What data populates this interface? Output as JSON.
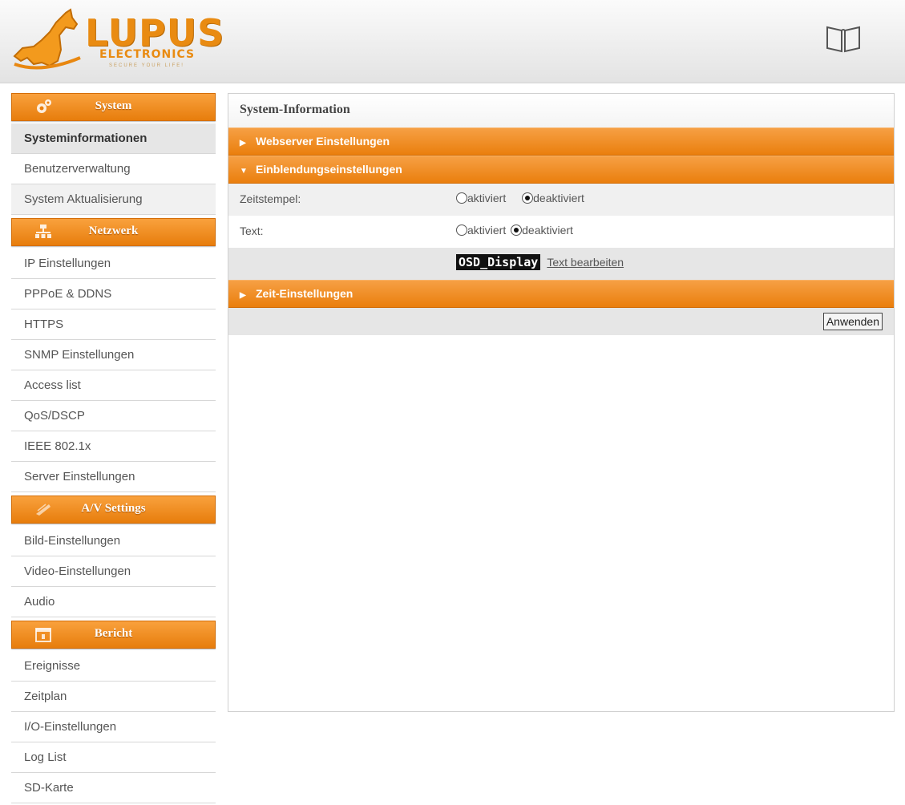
{
  "header": {
    "logo_name": "LUPUS",
    "logo_sub": "ELECTRONICS",
    "logo_tag": "SECURE YOUR LIFE!"
  },
  "sidebar": {
    "sections": [
      {
        "title": "System",
        "icon": "gear-icon",
        "items": [
          "Systeminformationen",
          "Benutzerverwaltung",
          "System Aktualisierung"
        ]
      },
      {
        "title": "Netzwerk",
        "icon": "network-icon",
        "items": [
          "IP Einstellungen",
          "PPPoE & DDNS",
          "HTTPS",
          "SNMP Einstellungen",
          "Access list",
          "QoS/DSCP",
          "IEEE 802.1x",
          "Server Einstellungen"
        ]
      },
      {
        "title": "A/V Settings",
        "icon": "av-icon",
        "items": [
          "Bild-Einstellungen",
          "Video-Einstellungen",
          "Audio"
        ]
      },
      {
        "title": "Bericht",
        "icon": "calendar-icon",
        "items": [
          "Ereignisse",
          "Zeitplan",
          "I/O-Einstellungen",
          "Log List",
          "SD-Karte"
        ]
      }
    ],
    "active_item": "Systeminformationen"
  },
  "main": {
    "title": "System-Information",
    "sections": {
      "webserver": "Webserver Einstellungen",
      "overlay": "Einblendungseinstellungen",
      "time": "Zeit-Einstellungen"
    },
    "timestamp_label": "Zeitstempel:",
    "text_label": "Text:",
    "option_on": "aktiviert",
    "option_off": "deaktiviert",
    "timestamp_selected": "deaktiviert",
    "text_selected": "deaktiviert",
    "osd_text": "OSD_Display",
    "edit_text_link": "Text bearbeiten",
    "apply_button": "Anwenden"
  },
  "colors": {
    "accent": "#ea7f0d",
    "accent_light": "#f6a044"
  }
}
